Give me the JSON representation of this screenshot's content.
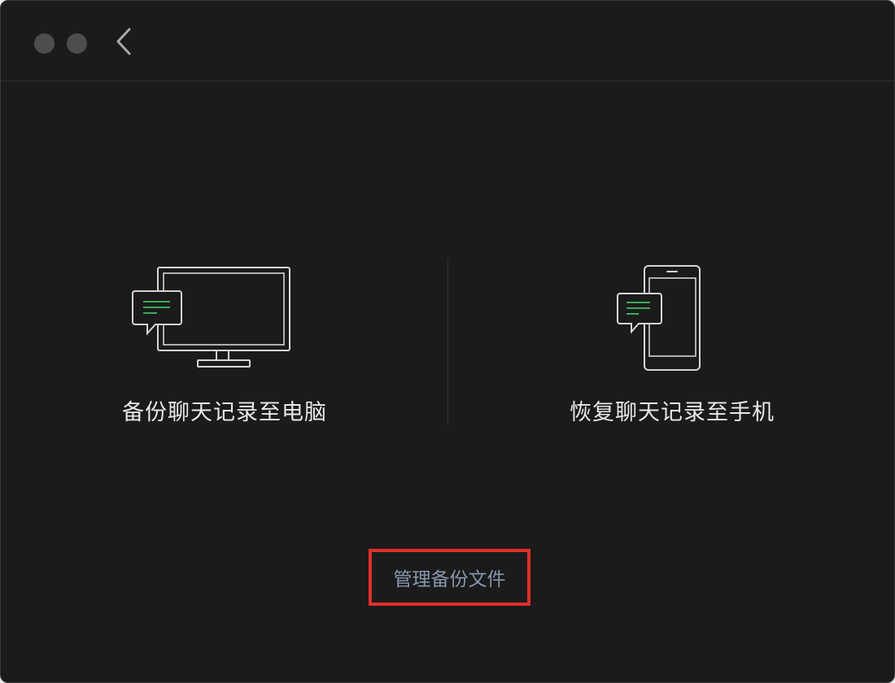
{
  "window": {
    "traffic_lights": [
      "close",
      "minimize"
    ],
    "back_icon": "chevron-left-icon"
  },
  "options": [
    {
      "label": "备份聊天记录至电脑",
      "icon": "monitor-chat-icon"
    },
    {
      "label": "恢复聊天记录至手机",
      "icon": "phone-chat-icon"
    }
  ],
  "manage_link": {
    "label": "管理备份文件",
    "highlight_color": "#e0302a"
  },
  "colors": {
    "background": "#1b1b1b",
    "accent_green": "#3fbf5f",
    "link": "#8797ad",
    "label": "#e8e8e8"
  }
}
